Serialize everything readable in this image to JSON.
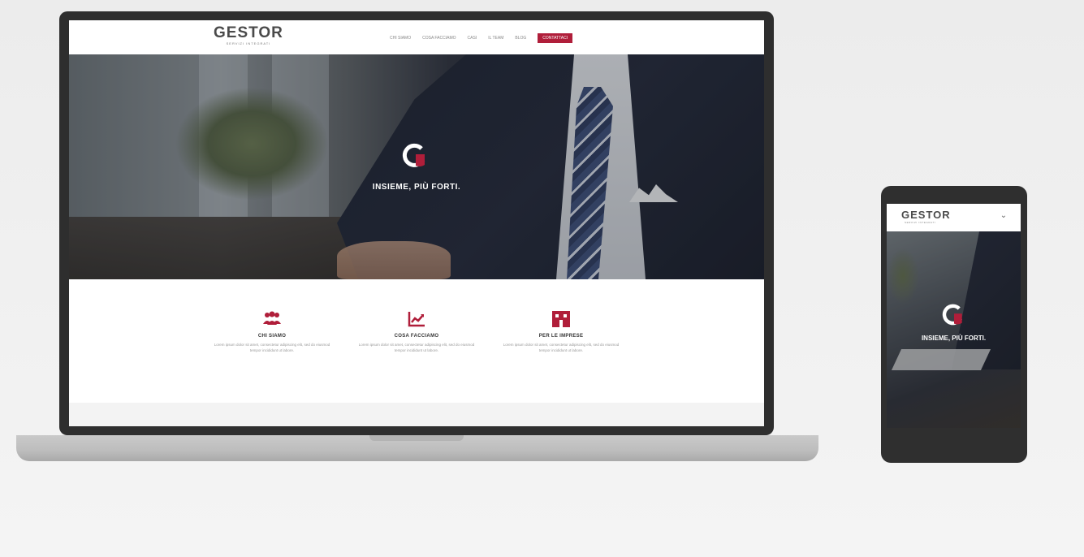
{
  "laptop": {
    "site": {
      "logo": "GESTOR",
      "logo_sub": "SERVIZI INTEGRATI",
      "nav": [
        "Chi siamo",
        "Cosa facciamo",
        "Casi",
        "Il team",
        "Blog"
      ],
      "nav_cta": "Contattaci",
      "hero_tagline": "INSIEME, PIÙ FORTI.",
      "features": [
        {
          "icon": "team-icon",
          "title": "Chi siamo",
          "text": "Lorem ipsum dolor sit amet, consectetur adipiscing elit, sed do eiusmod tempor incididunt ut labore."
        },
        {
          "icon": "growth-chart-icon",
          "title": "Cosa facciamo",
          "text": "Lorem ipsum dolor sit amet, consectetur adipiscing elit, sed do eiusmod tempor incididunt ut labore."
        },
        {
          "icon": "business-icon",
          "title": "Per le imprese",
          "text": "Lorem ipsum dolor sit amet, consectetur adipiscing elit, sed do eiusmod tempor incididunt ut labore."
        }
      ]
    }
  },
  "phone": {
    "site": {
      "logo": "GESTOR",
      "logo_sub": "SERVIZI INTEGRATI",
      "menu_icon": "chevron-down-icon",
      "hero_tagline": "INSIEME, PIÙ FORTI."
    }
  },
  "colors": {
    "accent": "#b01e3a",
    "device_frame": "#2e2e2e",
    "laptop_base": "#bdbdbd"
  }
}
